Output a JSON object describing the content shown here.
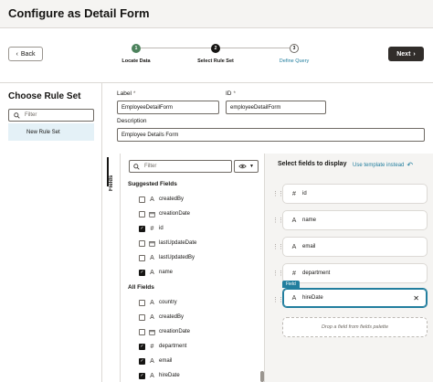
{
  "header": {
    "title": "Configure as Detail Form"
  },
  "nav": {
    "back_label": "Back",
    "next_label": "Next"
  },
  "train": {
    "steps": [
      {
        "number": "1",
        "label": "Locate Data",
        "state": "done"
      },
      {
        "number": "2",
        "label": "Select Rule Set",
        "state": "current"
      },
      {
        "number": "3",
        "label": "Define Query",
        "state": "next"
      }
    ]
  },
  "left_panel": {
    "title": "Choose Rule Set",
    "filter_placeholder": "Filter",
    "items": [
      {
        "label": "New Rule Set"
      }
    ]
  },
  "form": {
    "label_caption": "Label",
    "label_value": "EmployeeDetailForm",
    "id_caption": "ID",
    "id_value": "employeeDetailForm",
    "description_caption": "Description",
    "description_value": "Employee Details Form",
    "required_mark": "*"
  },
  "palette": {
    "tab_label": "Fields",
    "filter_placeholder": "Filter",
    "suggested_title": "Suggested Fields",
    "suggested": [
      {
        "label": "createdBy",
        "type_icon": "A",
        "checked": false
      },
      {
        "label": "creationDate",
        "type_icon": "calendar-icon",
        "checked": false
      },
      {
        "label": "id",
        "type_icon": "#",
        "checked": true
      },
      {
        "label": "lastUpdateDate",
        "type_icon": "calendar-icon",
        "checked": false
      },
      {
        "label": "lastUpdatedBy",
        "type_icon": "A",
        "checked": false
      },
      {
        "label": "name",
        "type_icon": "A",
        "checked": true
      }
    ],
    "all_title": "All Fields",
    "all": [
      {
        "label": "country",
        "type_icon": "A",
        "checked": false
      },
      {
        "label": "createdBy",
        "type_icon": "A",
        "checked": false
      },
      {
        "label": "creationDate",
        "type_icon": "calendar-icon",
        "checked": false
      },
      {
        "label": "department",
        "type_icon": "#",
        "checked": true
      },
      {
        "label": "email",
        "type_icon": "A",
        "checked": true
      },
      {
        "label": "hireDate",
        "type_icon": "A",
        "checked": true
      }
    ]
  },
  "selected": {
    "heading": "Select fields to display",
    "template_link": "Use template instead",
    "badge": "Field",
    "fields": [
      {
        "label": "id",
        "type_icon": "#"
      },
      {
        "label": "name",
        "type_icon": "A"
      },
      {
        "label": "email",
        "type_icon": "A"
      },
      {
        "label": "department",
        "type_icon": "#"
      },
      {
        "label": "hireDate",
        "type_icon": "A"
      }
    ],
    "drop_hint": "Drop a field from fields palette"
  },
  "colors": {
    "accent": "#227e9e",
    "done": "#4c825c",
    "primary_button": "#312d2a"
  }
}
